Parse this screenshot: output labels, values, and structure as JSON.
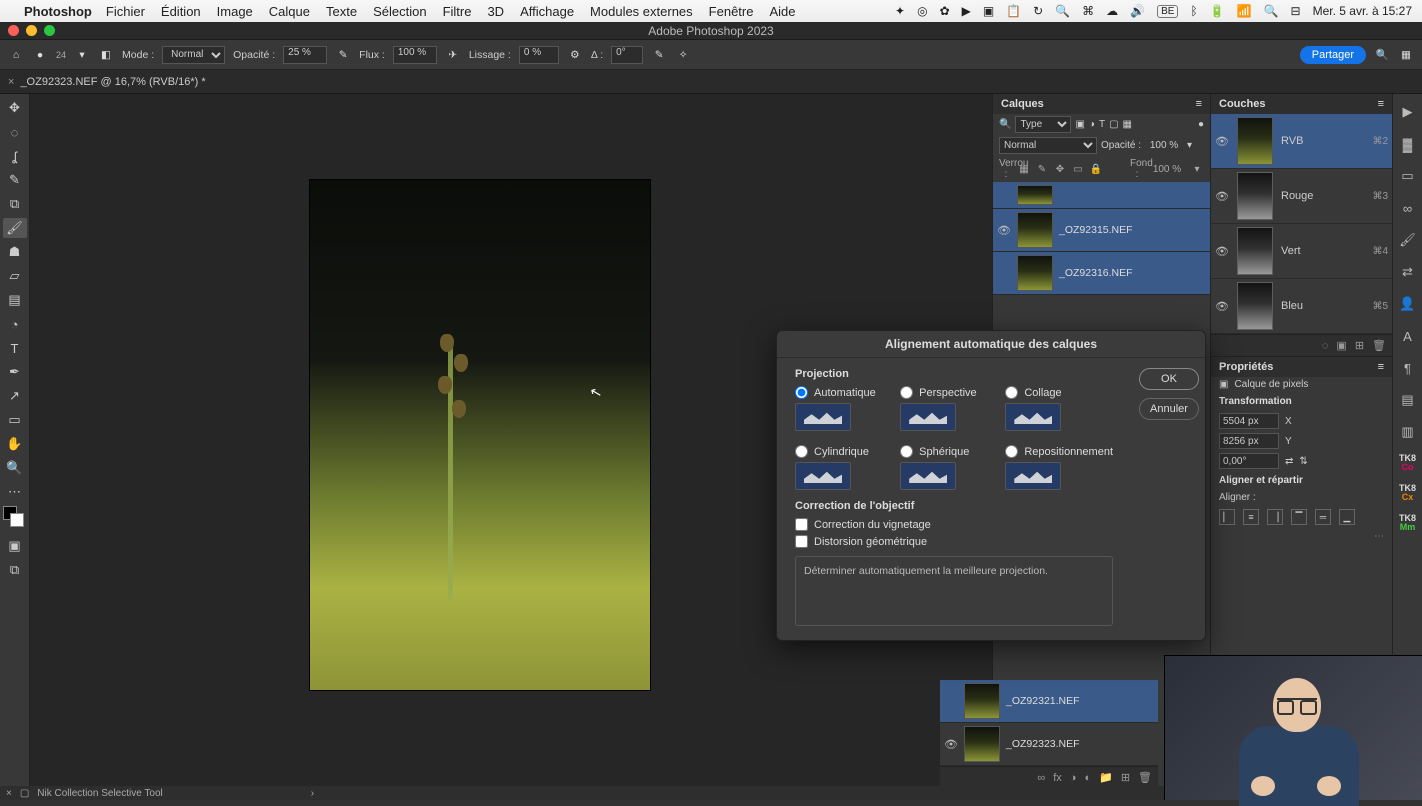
{
  "mac_menu": {
    "app": "Photoshop",
    "items": [
      "Fichier",
      "Édition",
      "Image",
      "Calque",
      "Texte",
      "Sélection",
      "Filtre",
      "3D",
      "Affichage",
      "Modules externes",
      "Fenêtre",
      "Aide"
    ],
    "clock": "Mer. 5 avr. à 15:27",
    "lang": "BE"
  },
  "window_title": "Adobe Photoshop 2023",
  "options_bar": {
    "brush_size": "24",
    "mode_label": "Mode :",
    "mode_value": "Normal",
    "opacity_label": "Opacité :",
    "opacity_value": "25 %",
    "flux_label": "Flux :",
    "flux_value": "100 %",
    "lissage_label": "Lissage :",
    "lissage_value": "0 %",
    "angle_label": "Δ :",
    "angle_value": "0°",
    "share": "Partager"
  },
  "doc_tab": "_OZ92323.NEF @ 16,7% (RVB/16*) *",
  "layers_panel": {
    "title": "Calques",
    "filter_label": "Type",
    "blend_mode": "Normal",
    "opacity_label": "Opacité :",
    "opacity_value": "100 %",
    "lock_label": "Verrou :",
    "fill_label": "Fond :",
    "fill_value": "100 %",
    "layers": [
      {
        "name": ""
      },
      {
        "name": "_OZ92315.NEF"
      },
      {
        "name": "_OZ92316.NEF"
      },
      {
        "name": "_OZ92321.NEF"
      },
      {
        "name": "_OZ92323.NEF"
      }
    ]
  },
  "channels_panel": {
    "title": "Couches",
    "channels": [
      {
        "name": "RVB",
        "shortcut": "⌘2",
        "color": true
      },
      {
        "name": "Rouge",
        "shortcut": "⌘3",
        "color": false
      },
      {
        "name": "Vert",
        "shortcut": "⌘4",
        "color": false
      },
      {
        "name": "Bleu",
        "shortcut": "⌘5",
        "color": false
      }
    ]
  },
  "properties_panel": {
    "title": "Propriétés",
    "kind": "Calque de pixels",
    "transform_title": "Transformation",
    "w": "5504 px",
    "w_axis": "X",
    "h": "8256 px",
    "h_axis": "Y",
    "angle": "0,00°",
    "align_title": "Aligner et répartir",
    "align_sub": "Aligner :"
  },
  "dialog": {
    "title": "Alignement automatique des calques",
    "projection_title": "Projection",
    "options": {
      "auto": "Automatique",
      "perspective": "Perspective",
      "collage": "Collage",
      "cylindrical": "Cylindrique",
      "spherical": "Sphérique",
      "reposition": "Repositionnement"
    },
    "lens_title": "Correction de l'objectif",
    "vignette": "Correction du vignetage",
    "distortion": "Distorsion géométrique",
    "info": "Déterminer automatiquement la meilleure projection.",
    "ok": "OK",
    "cancel": "Annuler"
  },
  "status_bar": {
    "nik": "Nik Collection Selective Tool"
  }
}
